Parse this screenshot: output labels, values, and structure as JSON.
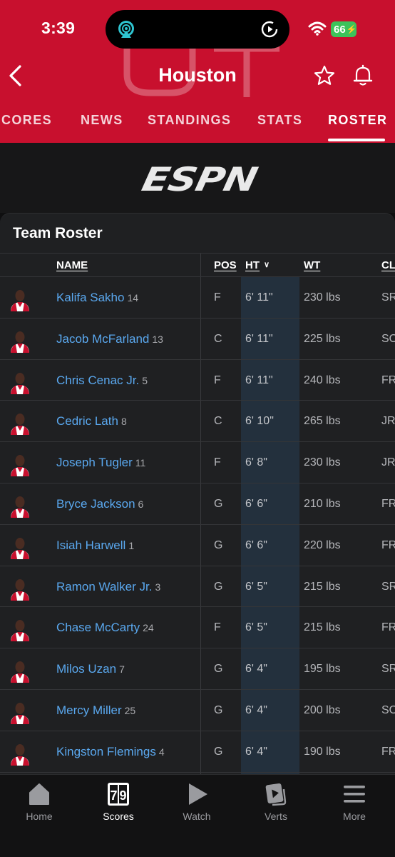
{
  "status_bar": {
    "time": "3:39",
    "battery": "66"
  },
  "header": {
    "title": "Houston"
  },
  "tabs": [
    {
      "label": "CORES",
      "active": false
    },
    {
      "label": "NEWS",
      "active": false
    },
    {
      "label": "STANDINGS",
      "active": false
    },
    {
      "label": "STATS",
      "active": false
    },
    {
      "label": "ROSTER",
      "active": true
    }
  ],
  "brand": {
    "logo_text": "ESPN"
  },
  "roster": {
    "title": "Team Roster",
    "columns": [
      "NAME",
      "POS",
      "HT",
      "WT",
      "CL"
    ],
    "players": [
      {
        "name": "Kalifa Sakho",
        "number": "14",
        "pos": "F",
        "ht": "6' 11\"",
        "wt": "230 lbs",
        "cl": "SR"
      },
      {
        "name": "Jacob McFarland",
        "number": "13",
        "pos": "C",
        "ht": "6' 11\"",
        "wt": "225 lbs",
        "cl": "SO"
      },
      {
        "name": "Chris Cenac Jr.",
        "number": "5",
        "pos": "F",
        "ht": "6' 11\"",
        "wt": "240 lbs",
        "cl": "FR"
      },
      {
        "name": "Cedric Lath",
        "number": "8",
        "pos": "C",
        "ht": "6' 10\"",
        "wt": "265 lbs",
        "cl": "JR"
      },
      {
        "name": "Joseph Tugler",
        "number": "11",
        "pos": "F",
        "ht": "6' 8\"",
        "wt": "230 lbs",
        "cl": "JR"
      },
      {
        "name": "Bryce Jackson",
        "number": "6",
        "pos": "G",
        "ht": "6' 6\"",
        "wt": "210 lbs",
        "cl": "FR"
      },
      {
        "name": "Isiah Harwell",
        "number": "1",
        "pos": "G",
        "ht": "6' 6\"",
        "wt": "220 lbs",
        "cl": "FR"
      },
      {
        "name": "Ramon Walker Jr.",
        "number": "3",
        "pos": "G",
        "ht": "6' 5\"",
        "wt": "215 lbs",
        "cl": "SR"
      },
      {
        "name": "Chase McCarty",
        "number": "24",
        "pos": "F",
        "ht": "6' 5\"",
        "wt": "215 lbs",
        "cl": "FR"
      },
      {
        "name": "Milos Uzan",
        "number": "7",
        "pos": "G",
        "ht": "6' 4\"",
        "wt": "195 lbs",
        "cl": "SR"
      },
      {
        "name": "Mercy Miller",
        "number": "25",
        "pos": "G",
        "ht": "6' 4\"",
        "wt": "200 lbs",
        "cl": "SO"
      },
      {
        "name": "Kingston Flemings",
        "number": "4",
        "pos": "G",
        "ht": "6' 4\"",
        "wt": "190 lbs",
        "cl": "FR"
      }
    ]
  },
  "tabbar": [
    {
      "label": "Home",
      "icon": "home-icon",
      "active": false
    },
    {
      "label": "Scores",
      "icon": "scoreboard-icon",
      "scoreboard_text": "79",
      "active": true
    },
    {
      "label": "Watch",
      "icon": "play-icon",
      "active": false
    },
    {
      "label": "Verts",
      "icon": "verts-icon",
      "active": false
    },
    {
      "label": "More",
      "icon": "menu-icon",
      "active": false
    }
  ],
  "colors": {
    "brand_red": "#c8102e",
    "link_blue": "#5aa8ef",
    "card_bg": "#1f2022",
    "ht_highlight": "#23303d"
  }
}
